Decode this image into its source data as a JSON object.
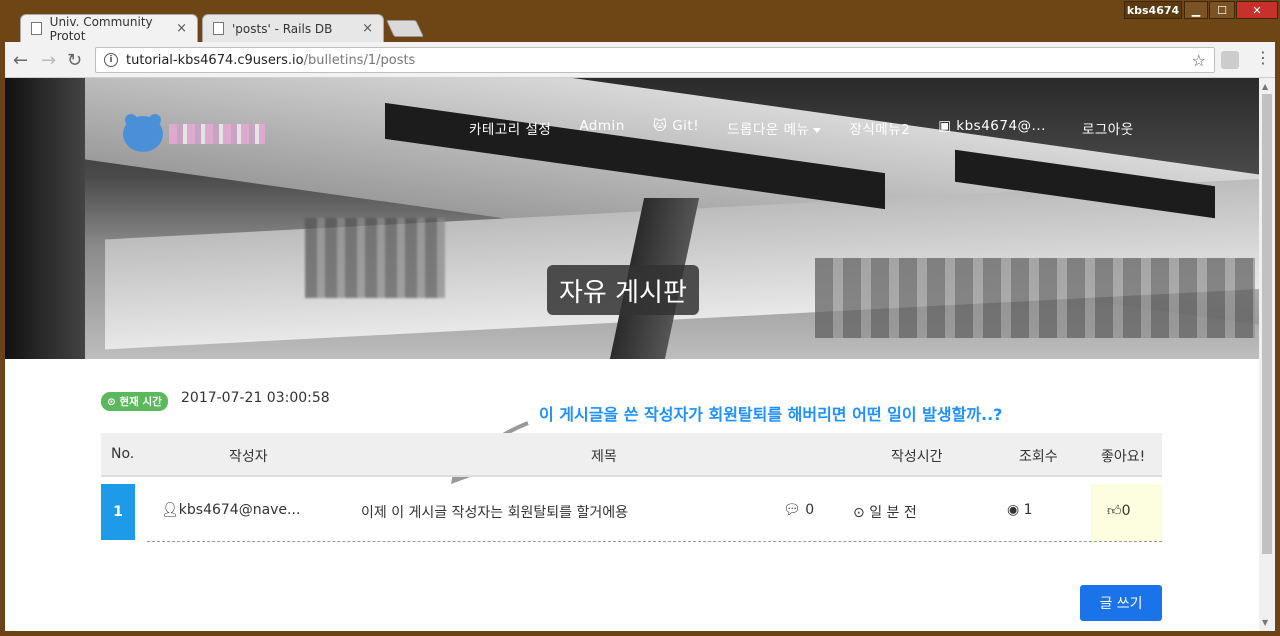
{
  "browser": {
    "tabs": [
      {
        "title": "Univ. Community Protot",
        "close": "×"
      },
      {
        "title": "'posts' - Rails DB",
        "close": "×"
      }
    ],
    "user_badge": "kbs4674",
    "url_host": "tutorial-kbs4674.c9users.io",
    "url_path": "/bulletins/1/posts",
    "back": "←",
    "forward": "→",
    "reload": "↻",
    "star": "☆",
    "menu": "⋮",
    "win_min": "▁",
    "win_max": "☐",
    "win_close": "✕"
  },
  "nav": {
    "items": [
      "카테고리 설정",
      "Admin",
      "Git!",
      "드롭다운 메뉴",
      "장식메뉴2",
      "kbs4674@...",
      "로그아웃"
    ]
  },
  "hero": {
    "title": "자유 게시판"
  },
  "time": {
    "badge": "현재 시간",
    "value": "2017-07-21 03:00:58"
  },
  "annotation": "이 게시글을 쓴 작성자가 회원탈퇴를 해버리면 어떤 일이 발생할까..?",
  "table": {
    "headers": [
      "No.",
      "작성자",
      "제목",
      "작성시간",
      "조회수",
      "좋아요!"
    ],
    "rows": [
      {
        "no": "1",
        "author": "kbs4674@nave...",
        "title": "이제 이 게시글 작성자는 회원탈퇴를 할거에용",
        "comments": "0",
        "time": "일 분 전",
        "views": "1",
        "likes": "0"
      }
    ]
  },
  "write_button": "글 쓰기",
  "colors": {
    "accent": "#1e9be8",
    "button": "#1a73e8",
    "badge": "#5cb85c",
    "annotation": "#1e90ff"
  }
}
